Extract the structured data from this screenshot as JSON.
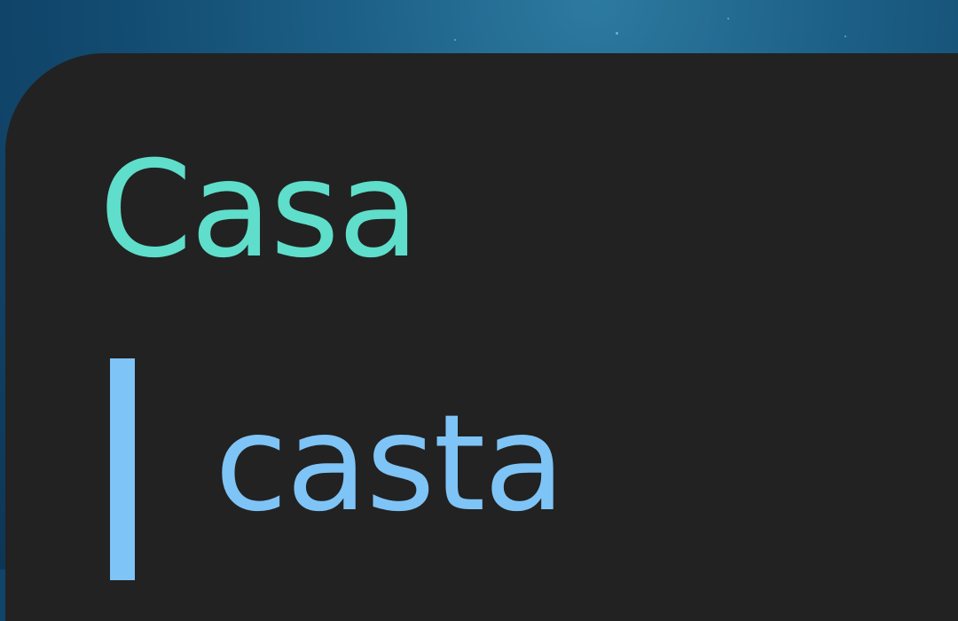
{
  "entry": {
    "title": "Casa",
    "suggestion": "casta"
  },
  "colors": {
    "panel_background": "#222222",
    "title_color": "#5fdecb",
    "suggestion_color": "#7fc4f7"
  }
}
